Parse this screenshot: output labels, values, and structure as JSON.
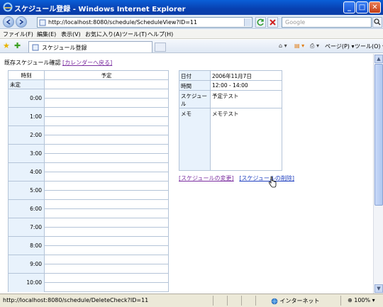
{
  "window": {
    "title": "スケジュール登録 - Windows Internet Explorer"
  },
  "address": {
    "url": "http://localhost:8080/schedule/ScheduleView?ID=11",
    "search_placeholder": "Google"
  },
  "menu": [
    "ファイル(F)",
    "編集(E)",
    "表示(V)",
    "お気に入り(A)",
    "ツール(T)",
    "ヘルプ(H)"
  ],
  "tab": {
    "label": "スケジュール登録"
  },
  "commands": {
    "page": "ページ(P)",
    "tools": "ツール(O)"
  },
  "page": {
    "heading": "既存スケジュール確認",
    "back_link": "[カレンダーへ戻る]",
    "schedule": {
      "col_time": "時刻",
      "col_plan": "予定",
      "undecided": "未定",
      "hours": [
        "0:00",
        "1:00",
        "2:00",
        "3:00",
        "4:00",
        "5:00",
        "6:00",
        "7:00",
        "8:00",
        "9:00",
        "10:00"
      ]
    },
    "detail": {
      "date_label": "日付",
      "date_value": "2006年11月7日",
      "time_label": "時間",
      "time_value": "12:00 - 14:00",
      "schedule_label": "スケジュール",
      "schedule_value": "予定テスト",
      "memo_label": "メモ",
      "memo_value": "メモテスト"
    },
    "edit_link": "[スケジュールの変更]",
    "delete_link": "[スケジュールの削除]"
  },
  "status": {
    "text": "http://localhost:8080/schedule/DeleteCheck?ID=11",
    "zone": "インターネット",
    "zoom": "100%"
  },
  "colors": {
    "titlebar": "#0a4fc8",
    "time_cell": "#e8f2fc",
    "visited_link": "#7b2ea0"
  }
}
